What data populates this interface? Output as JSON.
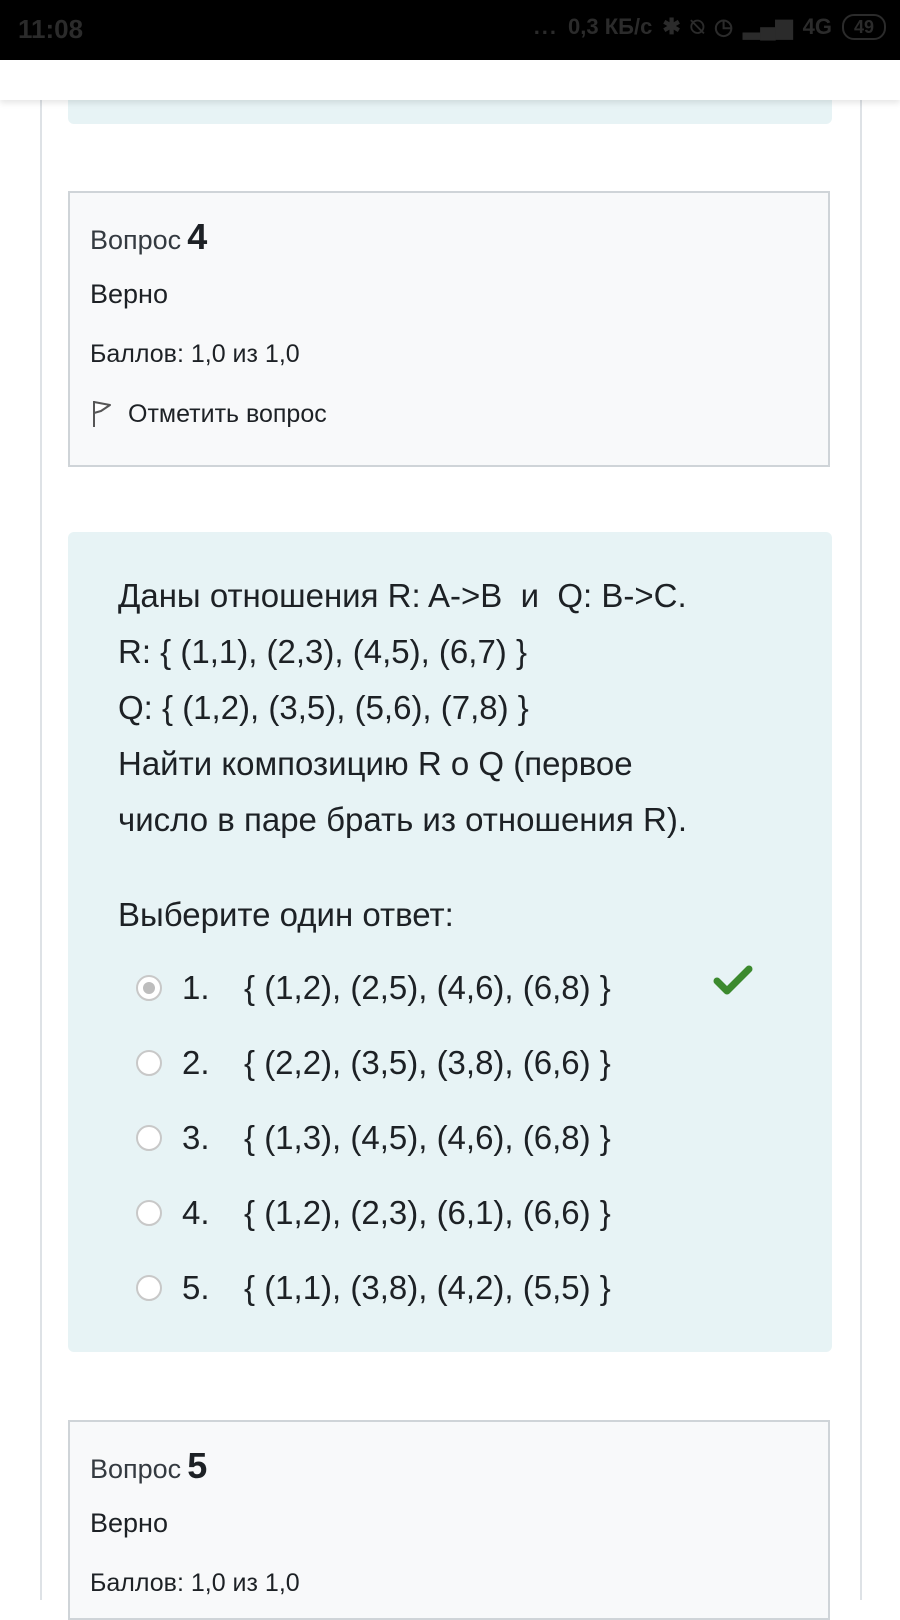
{
  "status_bar": {
    "time": "11:08",
    "dots": "...",
    "network_speed": "0,3 КБ/с",
    "network_type": "4G",
    "battery": "49",
    "icons": [
      "bluetooth-icon",
      "mute-icon",
      "alarm-icon",
      "signal-icon"
    ]
  },
  "question4_info": {
    "label": "Вопрос",
    "number": "4",
    "state": "Верно",
    "grade": "Баллов: 1,0 из 1,0",
    "flag_label": "Отметить вопрос"
  },
  "question": {
    "text_lines": [
      "Даны отношения R: A->B  и  Q: B->C.",
      "R: { (1,1), (2,3), (4,5), (6,7) }",
      "Q: { (1,2), (3,5), (5,6), (7,8) }",
      "Найти композицию R o Q (первое",
      "число в паре брать из отношения R)."
    ],
    "prompt": "Выберите один ответ:",
    "answers": [
      {
        "number": "1.",
        "text": "{ (1,2), (2,5), (4,6), (6,8) }",
        "selected": true,
        "correct": true
      },
      {
        "number": "2.",
        "text": "{ (2,2), (3,5), (3,8), (6,6) }",
        "selected": false,
        "correct": false
      },
      {
        "number": "3.",
        "text": "{ (1,3), (4,5), (4,6), (6,8) }",
        "selected": false,
        "correct": false
      },
      {
        "number": "4.",
        "text": "{ (1,2), (2,3), (6,1), (6,6) }",
        "selected": false,
        "correct": false
      },
      {
        "number": "5.",
        "text": "{ (1,1), (3,8), (4,2), (5,5) }",
        "selected": false,
        "correct": false
      }
    ]
  },
  "question5_info": {
    "label": "Вопрос",
    "number": "5",
    "state": "Верно",
    "grade": "Баллов: 1,0 из 1,0"
  },
  "colors": {
    "formulation_bg": "#e7f3f5",
    "info_bg": "#f8f9fa",
    "correct_check": "#3c8a2e",
    "text": "#1d2125"
  }
}
